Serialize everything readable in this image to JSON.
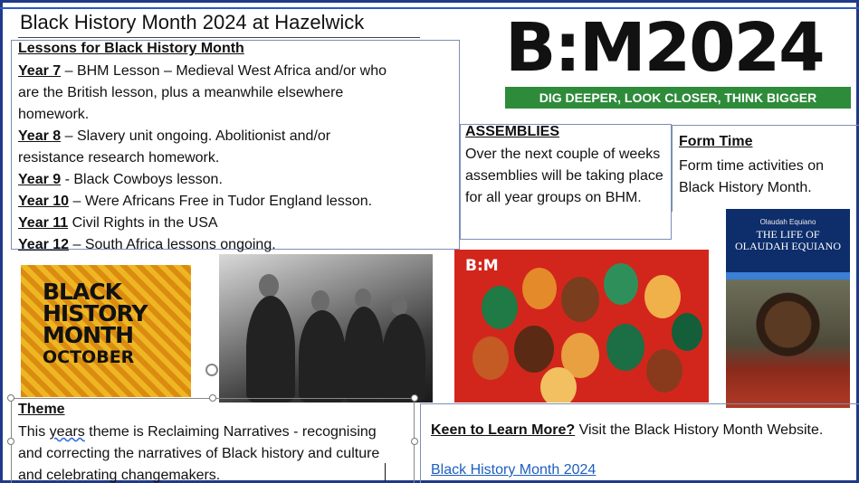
{
  "title": "Black History Month 2024 at Hazelwick",
  "lessons": {
    "heading": "Lessons for Black History Month",
    "lines": [
      {
        "year": "Year 7",
        "text": " – BHM Lesson – Medieval West Africa and/or who"
      },
      {
        "year": "",
        "text": "are the British lesson, plus a meanwhile elsewhere"
      },
      {
        "year": "",
        "text": "homework."
      },
      {
        "year": "Year 8",
        "text": " – Slavery unit ongoing.  Abolitionist and/or"
      },
      {
        "year": "",
        "text": "resistance research homework."
      },
      {
        "year": "Year 9",
        "text": "  - Black Cowboys lesson."
      },
      {
        "year": "Year 10",
        "text": " – Were Africans Free in Tudor England lesson."
      },
      {
        "year": "Year 11",
        "text": " Civil Rights in the USA"
      },
      {
        "year": "Year 12",
        "text": " – South Africa lessons ongoing."
      }
    ]
  },
  "logo": {
    "text": "B:M2024",
    "tagline": "DIG DEEPER, LOOK CLOSER, THINK BIGGER",
    "tagline_color": "#2e8b3a"
  },
  "assemblies": {
    "heading": "ASSEMBLIES",
    "body": "Over the next couple of weeks assemblies will be taking place for all year groups on BHM."
  },
  "form_time": {
    "heading": "Form Time",
    "body": "Form time activities on Black History Month."
  },
  "images": {
    "bhm_october": {
      "line1": "BLACK",
      "line2": "HISTORY",
      "line3": "MONTH",
      "month": "OCTOBER"
    },
    "portraits_logo": "B:M",
    "book": {
      "author": "Olaudah Equiano",
      "title1": "THE LIFE OF",
      "title2": "OLAUDAH EQUIANO"
    }
  },
  "theme": {
    "heading": "Theme",
    "pre": "This ",
    "squiggle": "years",
    "post": " theme is Reclaiming Narratives - recognising and correcting the narratives of Black history and culture and celebrating changemakers."
  },
  "learn_more": {
    "question": "Keen to Learn More?",
    "text": " Visit the Black History Month Website.",
    "link": "Black History Month 2024",
    "link_color": "#1d5fbf"
  }
}
